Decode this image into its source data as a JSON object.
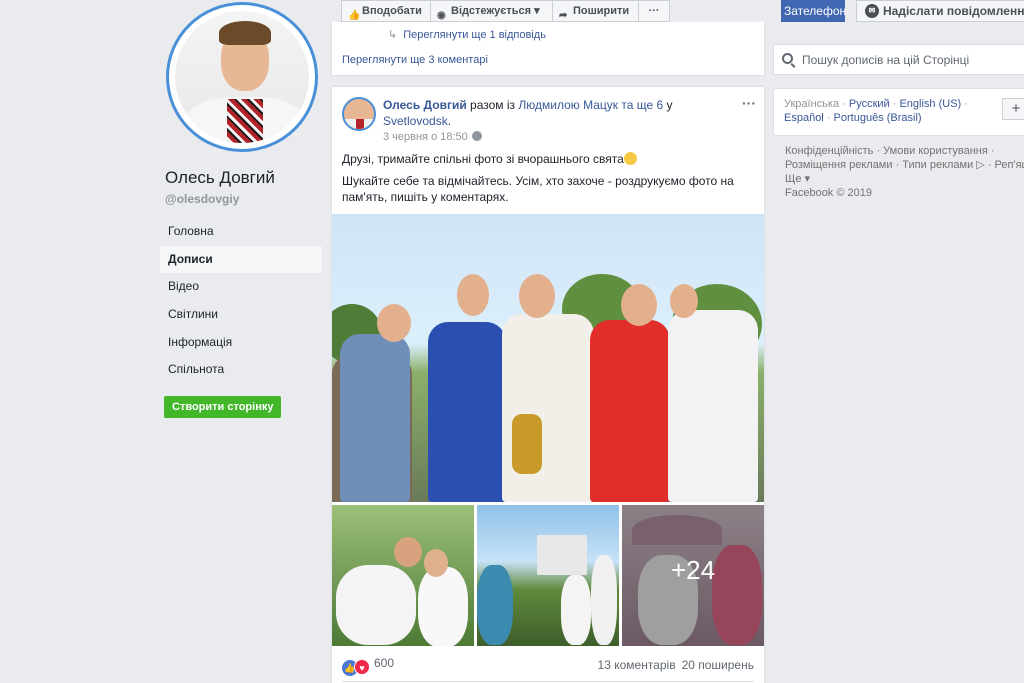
{
  "page": {
    "name": "Олесь Довгий",
    "handle": "@olesdovgiy"
  },
  "left_nav": {
    "items": [
      "Головна",
      "Дописи",
      "Відео",
      "Світлини",
      "Інформація",
      "Спільнота"
    ],
    "active": "Дописи",
    "create_page": "Створити сторінку"
  },
  "topbar": {
    "like": "Вподобати",
    "follow": "Відстежується",
    "share": "Поширити",
    "more": "···",
    "call": "Зателефонувати",
    "message": "Надіслати повідомлення"
  },
  "prev_post": {
    "view_reply": "Переглянути ще 1 відповідь",
    "view_more": "Переглянути ще 3 коментарі"
  },
  "post": {
    "author": "Олесь Довгий",
    "with_text": " разом із ",
    "tagged": "Людмилою Мацук",
    "and_more": " та ще 6",
    "in_text": " у ",
    "location": "Svetlovodsk",
    "period": ".",
    "time": "3 червня о 18:50",
    "text1": "Друзі, тримайте спільні фото зі вчорашнього свята",
    "text2": "Шукайте себе та відмічайтесь. Усім, хто захоче - роздрукуємо фото на пам'ять, пишіть у коментарях.",
    "extra_photos": "+24",
    "reactions_count": "600",
    "comments": "13 коментарів",
    "shares": "20 поширень"
  },
  "search": {
    "placeholder": "Пошук дописів на цій Сторінці"
  },
  "languages": {
    "current": "Українська",
    "others": [
      "Русский",
      "English (US)",
      "Español",
      "Português (Brasil)"
    ],
    "add": "+"
  },
  "footer": {
    "line1": "Конфіденційність · Умови користування ·",
    "line2": "Розміщення реклами · Типи реклами ▷ · Реп'яшки ·",
    "line3": "Ще ▾",
    "copyright": "Facebook © 2019"
  },
  "colors": {
    "fb_blue": "#4267b2",
    "link": "#385898",
    "green": "#42b72a",
    "background": "#e9ebee"
  }
}
